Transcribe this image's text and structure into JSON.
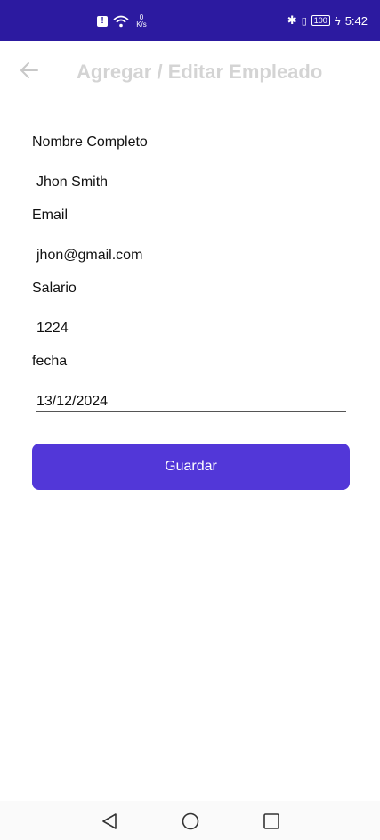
{
  "status_bar": {
    "alert_glyph": "!",
    "net_speed_value": "0",
    "net_speed_unit": "K/s",
    "bluetooth_glyph": "✱",
    "vibrate_glyph": "▯",
    "battery": "100",
    "charging_glyph": "ϟ",
    "time": "5:42"
  },
  "app_bar": {
    "back_icon": "arrow-left",
    "title": "Agregar / Editar Empleado"
  },
  "form": {
    "fields": [
      {
        "label": "Nombre Completo",
        "value": "Jhon Smith"
      },
      {
        "label": "Email",
        "value": "jhon@gmail.com"
      },
      {
        "label": "Salario",
        "value": "1224"
      },
      {
        "label": "fecha",
        "value": "13/12/2024"
      }
    ],
    "save_label": "Guardar"
  },
  "nav_bar": {
    "back_icon": "triangle-back",
    "home_icon": "circle-home",
    "recents_icon": "square-recents"
  },
  "colors": {
    "status_bar": "#2c1aa0",
    "primary_button": "#5237d8",
    "title_text": "#d4d4d4"
  }
}
